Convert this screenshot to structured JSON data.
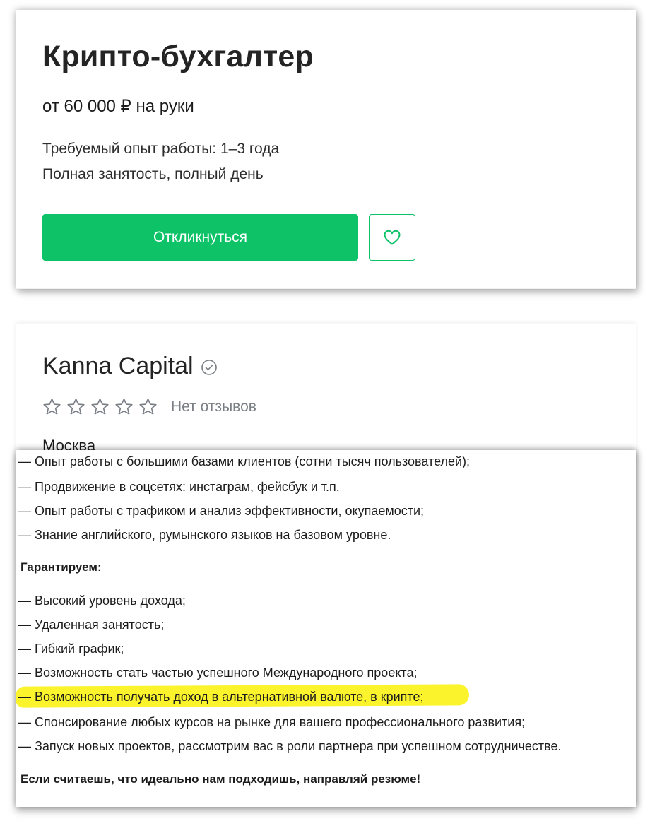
{
  "vacancy": {
    "title": "Крипто-бухгалтер",
    "salary": "от 60 000 ₽ на руки",
    "experience": "Требуемый опыт работы: 1–3 года",
    "employment": "Полная занятость, полный день",
    "apply_label": "Откликнуться",
    "favorite_icon": "heart-icon"
  },
  "company": {
    "name": "Kanna Capital",
    "verified_icon": "check-circle-icon",
    "rating": 0,
    "rating_max": 5,
    "reviews_label": "Нет отзывов",
    "city": "Москва"
  },
  "description": {
    "requirements_tail": [
      "— Опыт работы с большими базами клиентов (сотни тысяч пользователей);",
      "— Продвижение в соцсетях: инстаграм, фейсбук и т.п.",
      "— Опыт работы с трафиком и анализ эффективности, окупаемости;",
      "— Знание английского, румынского языков на базовом уровне."
    ],
    "guarantee_heading": "Гарантируем:",
    "guarantees": [
      "— Высокий уровень дохода;",
      "— Удаленная занятость;",
      "— Гибкий график;",
      "— Возможность стать частью успешного Международного проекта;",
      "— Возможность получать доход в альтернативной валюте, в крипте;",
      "— Спонсирование любых курсов на рынке для вашего профессионального развития;",
      "— Запуск новых проектов, рассмотрим вас в роли партнера при успешном сотрудничестве."
    ],
    "highlight_color": "#fbf32c",
    "closing": "Если считаешь, что идеально нам подходишь, направляй резюме!"
  },
  "colors": {
    "accent_green": "#0dc267",
    "muted_text": "#7a7f85"
  }
}
